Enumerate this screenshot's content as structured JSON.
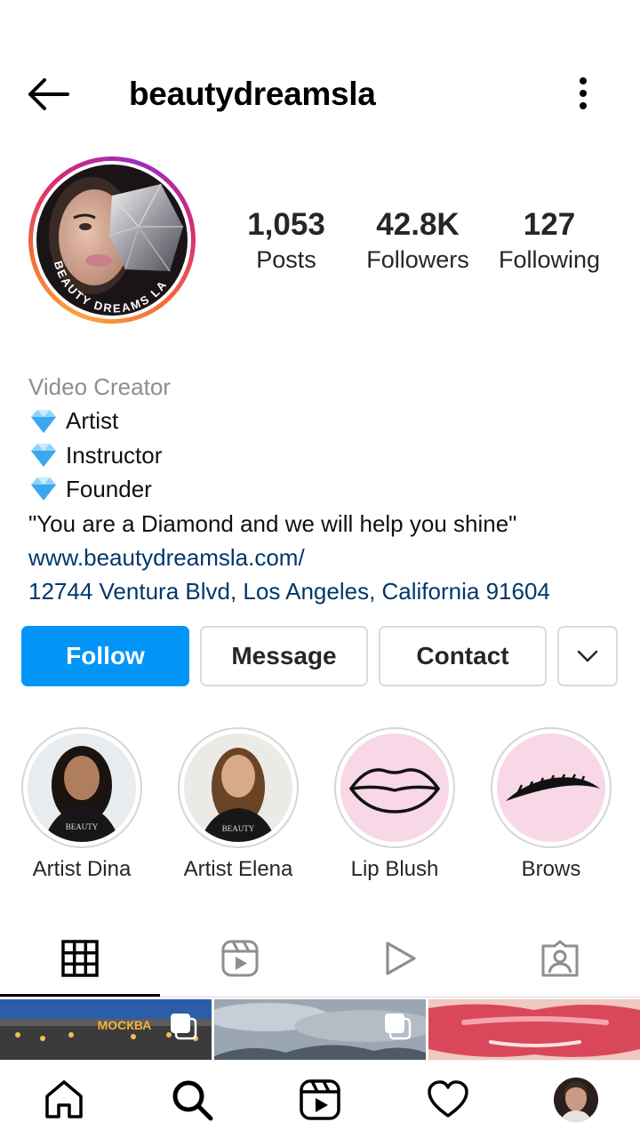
{
  "header": {
    "username": "beautydreamsla",
    "back_icon": "arrow-left-icon",
    "more_icon": "more-vertical-icon"
  },
  "profile": {
    "avatar_text": "BEAUTY DREAMS LA",
    "stats": [
      {
        "value": "1,053",
        "label": "Posts"
      },
      {
        "value": "42.8K",
        "label": "Followers"
      },
      {
        "value": "127",
        "label": "Following"
      }
    ]
  },
  "bio": {
    "category": "Video Creator",
    "roles": [
      "Artist",
      "Instructor",
      "Founder"
    ],
    "quote": "\"You are a Diamond and we will help you shine\"",
    "website": "www.beautydreamsla.com/",
    "address": "12744 Ventura Blvd, Los Angeles, California 91604"
  },
  "actions": {
    "follow": "Follow",
    "message": "Message",
    "contact": "Contact"
  },
  "highlights": [
    {
      "label": "Artist Dina"
    },
    {
      "label": "Artist Elena"
    },
    {
      "label": "Lip Blush"
    },
    {
      "label": "Brows"
    }
  ],
  "grid": {
    "post1_sign": "МОСКВА"
  },
  "colors": {
    "follow_blue": "#0095f6",
    "link_blue": "#00376b",
    "highlight_pink": "#f8d7e6"
  }
}
